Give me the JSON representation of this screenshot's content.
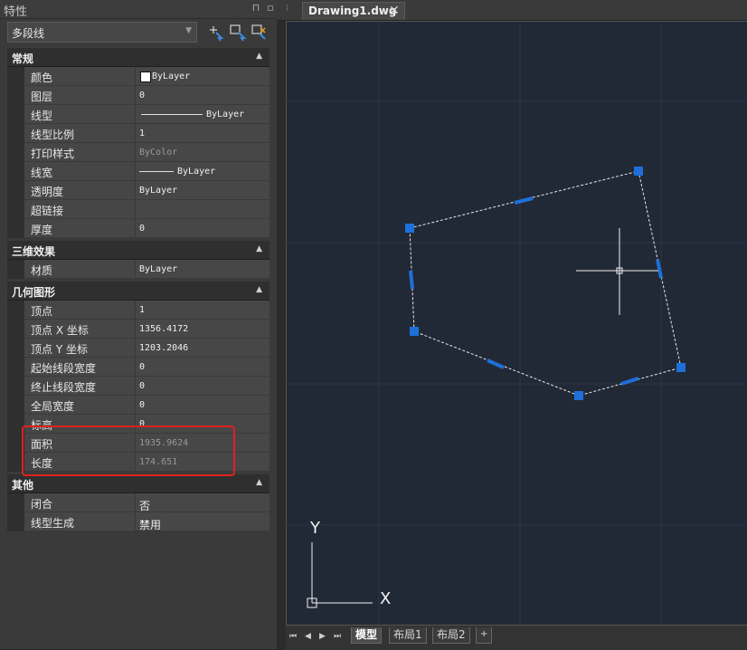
{
  "panel": {
    "title": "特性",
    "pin_icon": "pin-icon",
    "minimize_icon": "minimize-icon",
    "close_icon": "close-icon",
    "selector_value": "多段线",
    "tools": [
      "select-objects-icon",
      "quick-select-icon",
      "toggle-pickadd-icon"
    ]
  },
  "sections": {
    "general": {
      "title": "常规",
      "rows": [
        {
          "name": "颜色",
          "value": "ByLayer"
        },
        {
          "name": "图层",
          "value": "0"
        },
        {
          "name": "线型",
          "value": "ByLayer"
        },
        {
          "name": "线型比例",
          "value": "1"
        },
        {
          "name": "打印样式",
          "value": "ByColor"
        },
        {
          "name": "线宽",
          "value": "ByLayer"
        },
        {
          "name": "透明度",
          "value": "ByLayer"
        },
        {
          "name": "超链接",
          "value": ""
        },
        {
          "name": "厚度",
          "value": "0"
        }
      ]
    },
    "3d": {
      "title": "三维效果",
      "rows": [
        {
          "name": "材质",
          "value": "ByLayer"
        }
      ]
    },
    "geometry": {
      "title": "几何图形",
      "rows": [
        {
          "name": "顶点",
          "value": "1"
        },
        {
          "name": "顶点 X 坐标",
          "value": "1356.4172"
        },
        {
          "name": "顶点 Y 坐标",
          "value": "1203.2046"
        },
        {
          "name": "起始线段宽度",
          "value": "0"
        },
        {
          "name": "终止线段宽度",
          "value": "0"
        },
        {
          "name": "全局宽度",
          "value": "0"
        },
        {
          "name": "标高",
          "value": "0"
        },
        {
          "name": "面积",
          "value": "1935.9624"
        },
        {
          "name": "长度",
          "value": "174.651"
        }
      ]
    },
    "misc": {
      "title": "其他",
      "rows": [
        {
          "name": "闭合",
          "value": "否"
        },
        {
          "name": "线型生成",
          "value": "禁用"
        }
      ]
    }
  },
  "drawing": {
    "tab_label": "Drawing1.dwg",
    "tab_close": "✕",
    "ucs_y": "Y",
    "ucs_x": "X",
    "grip_color": "#1e6fd9",
    "background_color": "#222936"
  },
  "sheets": {
    "nav": [
      "⏮",
      "◀",
      "▶",
      "⏭"
    ],
    "tabs": [
      "模型",
      "布局1",
      "布局2",
      "+"
    ]
  }
}
